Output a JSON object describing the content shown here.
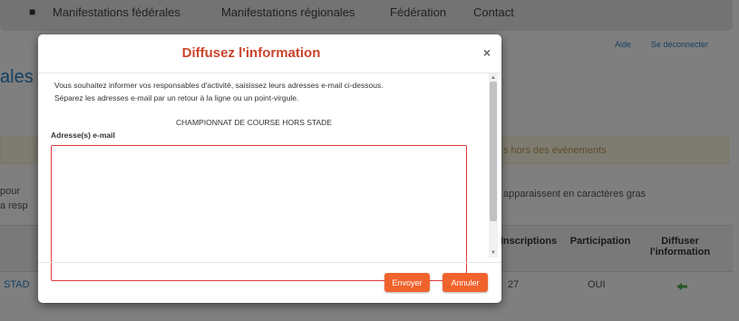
{
  "nav": {
    "items": [
      "Manifestations fédérales",
      "Manifestations régionales",
      "Fédération",
      "Contact"
    ]
  },
  "page": {
    "side_title": "ales",
    "top_right": {
      "help": "Aide",
      "logout": "Se déconnecter"
    },
    "alert_right": "s hors des évènements",
    "left_stub_1": "pour",
    "left_stub_2": "a resp",
    "right_note": "apparaissent en caractères gras",
    "table": {
      "headers": [
        "Inscriptions",
        "Participation",
        "Diffuser l'information"
      ],
      "row": {
        "link": "STAD",
        "inscriptions": "27",
        "participation": "OUI"
      }
    }
  },
  "modal": {
    "title": "Diffusez l'information",
    "close": "×",
    "intro_line1": "Vous souhaitez informer vos responsables d'activité, saisissez leurs adresses e-mail ci-dessous.",
    "intro_line2": "Séparez les adresses e-mail par un retour à la ligne ou un point-virgule.",
    "event_name": "CHAMPIONNAT DE COURSE HORS STADE",
    "field_label": "Adresse(s) e-mail",
    "field_value": "",
    "send_label": "Envoyer",
    "cancel_label": "Annuler"
  },
  "colors": {
    "accent": "#f0632d",
    "title": "#c9452d",
    "error_border": "#e03a3a",
    "link": "#2d7fbf"
  },
  "icons": {
    "home": "home-icon",
    "close": "close-icon",
    "distribute": "share-icon"
  }
}
